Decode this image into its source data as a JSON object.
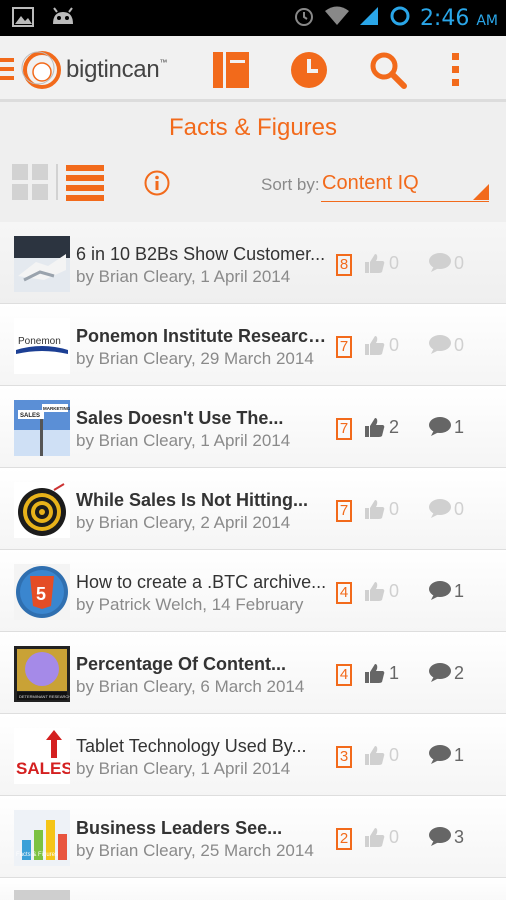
{
  "status_bar": {
    "time": "2:46",
    "ampm": "AM",
    "left_icons": [
      "image-icon",
      "android-icon"
    ],
    "right_icons": [
      "alarm-icon",
      "wifi-icon",
      "signal-icon",
      "sync-icon"
    ]
  },
  "app_bar": {
    "brand": "bigtincan",
    "trademark": "™",
    "actions": [
      "library-icon",
      "recent-icon",
      "search-icon",
      "overflow-menu-icon"
    ]
  },
  "page": {
    "title": "Facts & Figures"
  },
  "toolbar": {
    "sort_label": "Sort by:",
    "sort_value": "Content IQ"
  },
  "colors": {
    "accent": "#f26a1b",
    "muted": "#d0d0d0",
    "text": "#333333",
    "meta": "#8a8a8a"
  },
  "items": [
    {
      "title": "6 in 10 B2Bs Show Customer...",
      "meta": "by Brian Cleary, 1 April 2014",
      "iq": "8",
      "likes": "0",
      "comments": "0",
      "bold": false,
      "thumb": "handshake"
    },
    {
      "title": "Ponemon Institute Research...",
      "meta": "by Brian Cleary, 29 March 2014",
      "iq": "7",
      "likes": "0",
      "comments": "0",
      "bold": true,
      "thumb": "ponemon"
    },
    {
      "title": "Sales Doesn't Use The...",
      "meta": "by Brian Cleary, 1 April 2014",
      "iq": "7",
      "likes": "2",
      "comments": "1",
      "bold": true,
      "thumb": "signpost"
    },
    {
      "title": "While Sales Is Not Hitting...",
      "meta": "by Brian Cleary, 2 April 2014",
      "iq": "7",
      "likes": "0",
      "comments": "0",
      "bold": true,
      "thumb": "target"
    },
    {
      "title": "How to create a .BTC archive...",
      "meta": "by Patrick Welch, 14 February",
      "iq": "4",
      "likes": "0",
      "comments": "1",
      "bold": false,
      "thumb": "html5"
    },
    {
      "title": "Percentage Of Content...",
      "meta": "by Brian Cleary, 6 March 2014",
      "iq": "4",
      "likes": "1",
      "comments": "2",
      "bold": true,
      "thumb": "circle"
    },
    {
      "title": "Tablet Technology Used By...",
      "meta": "by Brian Cleary, 1 April 2014",
      "iq": "3",
      "likes": "0",
      "comments": "1",
      "bold": false,
      "thumb": "sales"
    },
    {
      "title": "Business Leaders See...",
      "meta": "by Brian Cleary, 25 March 2014",
      "iq": "2",
      "likes": "0",
      "comments": "3",
      "bold": true,
      "thumb": "facts"
    }
  ],
  "thumb_text": {
    "ponemon": "Ponemon",
    "signpost_a": "SALES",
    "signpost_b": "MARKETING",
    "html5": "5",
    "circle": "DETERMINANT RESEARCH",
    "sales": "SALES",
    "facts": "Facts & Figures"
  }
}
